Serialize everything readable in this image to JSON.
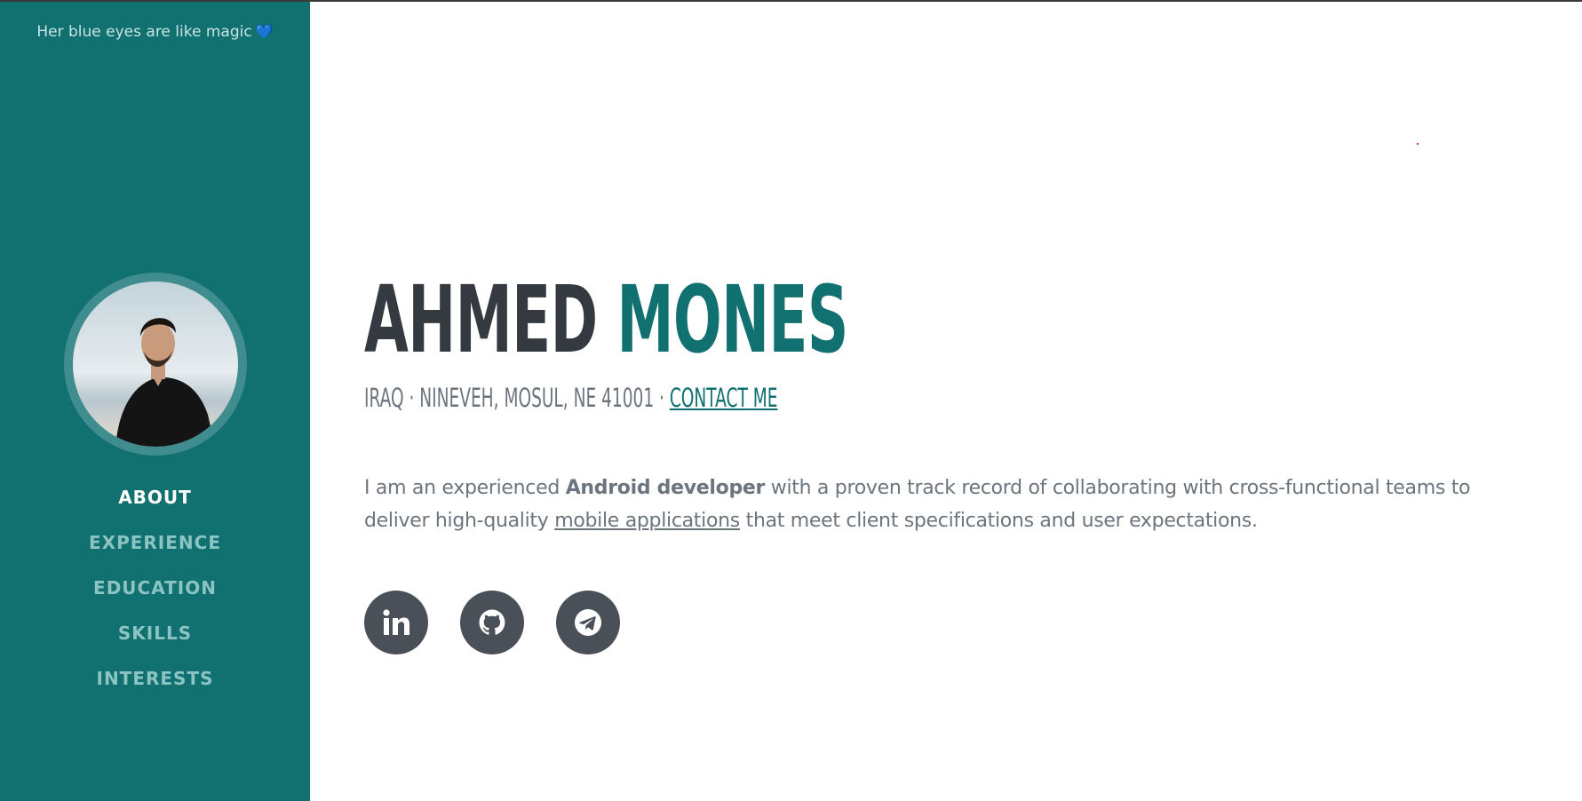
{
  "sidebar": {
    "tagline": "Her blue eyes are like magic",
    "tagline_emoji": "💙",
    "nav": [
      {
        "label": "ABOUT",
        "active": true
      },
      {
        "label": "EXPERIENCE",
        "active": false
      },
      {
        "label": "EDUCATION",
        "active": false
      },
      {
        "label": "SKILLS",
        "active": false
      },
      {
        "label": "INTERESTS",
        "active": false
      }
    ]
  },
  "profile": {
    "first_name": "AHMED",
    "last_name": "MONES",
    "address": "IRAQ · NINEVEH, MOSUL, NE 41001 · ",
    "contact_label": "CONTACT ME",
    "bio_prefix": "I am an experienced ",
    "bio_bold": "Android developer",
    "bio_mid": " with a proven track record of collaborating with cross-functional teams to deliver high-quality ",
    "bio_link": "mobile applications",
    "bio_suffix": " that meet client specifications and user expectations."
  },
  "social": [
    {
      "icon": "linkedin-icon"
    },
    {
      "icon": "github-icon"
    },
    {
      "icon": "telegram-icon"
    }
  ],
  "colors": {
    "sidebar_bg": "#117070",
    "accent": "#117070",
    "heading_dark": "#343a40",
    "text_muted": "#6c757d",
    "social_bg": "#495057"
  }
}
